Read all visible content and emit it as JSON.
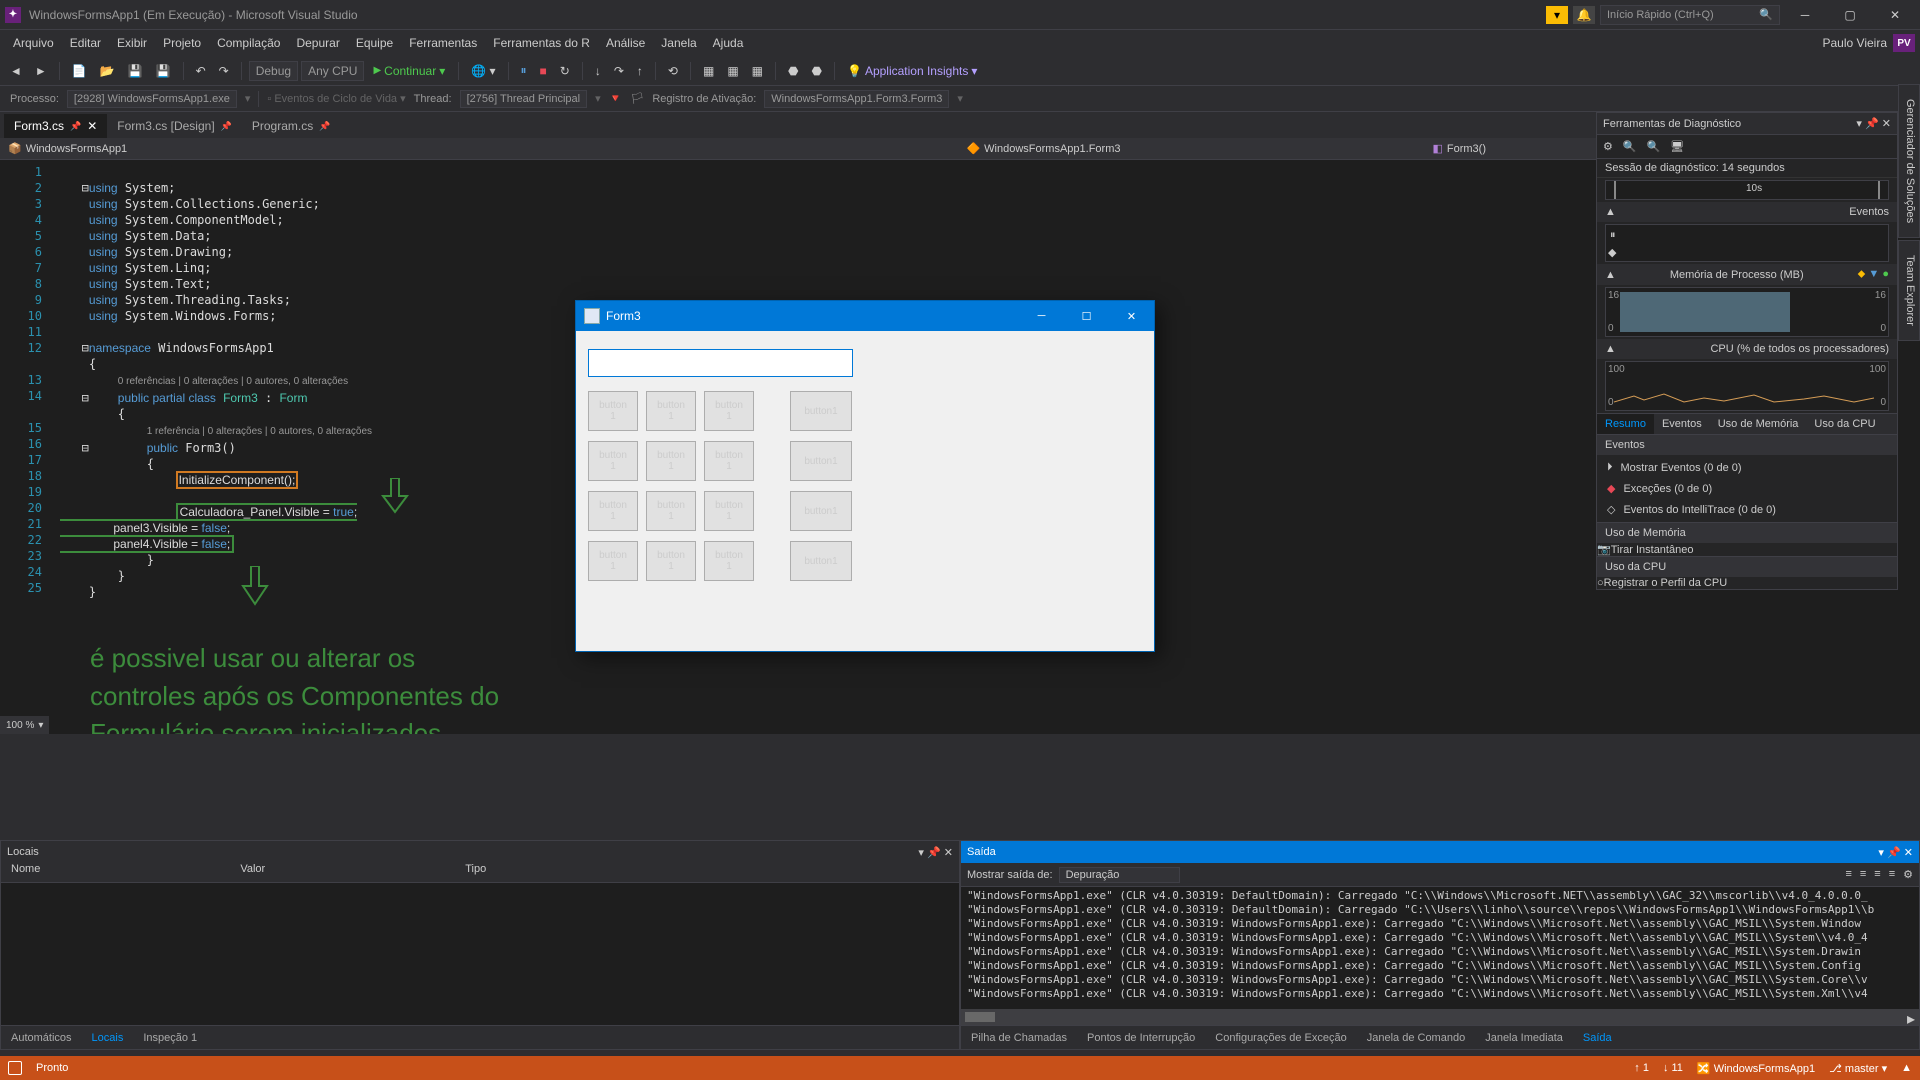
{
  "title": "WindowsFormsApp1 (Em Execução) - Microsoft Visual Studio",
  "quickLaunch": "Início Rápido (Ctrl+Q)",
  "user": {
    "name": "Paulo Vieira",
    "initials": "PV"
  },
  "menu": [
    "Arquivo",
    "Editar",
    "Exibir",
    "Projeto",
    "Compilação",
    "Depurar",
    "Equipe",
    "Ferramentas",
    "Ferramentas do R",
    "Análise",
    "Janela",
    "Ajuda"
  ],
  "toolbar": {
    "config": "Debug",
    "platform": "Any CPU",
    "continue": "Continuar",
    "appInsights": "Application Insights"
  },
  "process": {
    "label": "Processo:",
    "value": "[2928] WindowsFormsApp1.exe",
    "lifecycle": "Eventos de Ciclo de Vida",
    "thread": "Thread:",
    "threadValue": "[2756] Thread Principal",
    "activation": "Registro de Ativação:",
    "activationValue": "WindowsFormsApp1.Form3.Form3"
  },
  "tabs": [
    {
      "label": "Form3.cs",
      "active": true,
      "pinned": true
    },
    {
      "label": "Form3.cs [Design]",
      "active": false,
      "pinned": true
    },
    {
      "label": "Program.cs",
      "active": false,
      "pinned": true
    }
  ],
  "breadcrumb": {
    "project": "WindowsFormsApp1",
    "class": "WindowsFormsApp1.Form3",
    "method": "Form3()"
  },
  "zoom": "100 %",
  "code": {
    "lines": [
      "1",
      "2",
      "3",
      "4",
      "5",
      "6",
      "7",
      "8",
      "9",
      "10",
      "11",
      "12",
      "13",
      "14",
      "15",
      "16",
      "17",
      "18",
      "19",
      "20",
      "21",
      "22",
      "23",
      "24",
      "25"
    ]
  },
  "annotation": "é possivel usar ou alterar os\ncontroles após os Componentes do\nFormulário serem inicializados.",
  "runForm": {
    "title": "Form3",
    "buttonLabel": "button\n1",
    "wideLabel": "button1"
  },
  "diag": {
    "title": "Ferramentas de Diagnóstico",
    "session": "Sessão de diagnóstico: 14 segundos",
    "timeMark": "10s",
    "events": "Eventos",
    "memory": "Memória de Processo (MB)",
    "memTick": "16",
    "memZero": "0",
    "cpu": "CPU (% de todos os processadores)",
    "cpuTick": "100",
    "cpuZero": "0",
    "tabs": [
      "Resumo",
      "Eventos",
      "Uso de Memória",
      "Uso da CPU"
    ],
    "evHead": "Eventos",
    "ev1": "Mostrar Eventos (0 de 0)",
    "ev2": "Exceções (0 de 0)",
    "ev3": "Eventos do IntelliTrace (0 de 0)",
    "memHead": "Uso de Memória",
    "memAct": "Tirar Instantâneo",
    "cpuHead": "Uso da CPU",
    "cpuAct": "Registrar o Perfil da CPU"
  },
  "locals": {
    "title": "Locais",
    "cols": [
      "Nome",
      "Valor",
      "Tipo"
    ],
    "tabs": [
      "Automáticos",
      "Locais",
      "Inspeção 1"
    ]
  },
  "output": {
    "title": "Saída",
    "showFrom": "Mostrar saída de:",
    "source": "Depuração",
    "lines": [
      "\"WindowsFormsApp1.exe\" (CLR v4.0.30319: DefaultDomain): Carregado \"C:\\\\Windows\\\\Microsoft.NET\\\\assembly\\\\GAC_32\\\\mscorlib\\\\v4.0_4.0.0.0_",
      "\"WindowsFormsApp1.exe\" (CLR v4.0.30319: DefaultDomain): Carregado \"C:\\\\Users\\\\linho\\\\source\\\\repos\\\\WindowsFormsApp1\\\\WindowsFormsApp1\\\\b",
      "\"WindowsFormsApp1.exe\" (CLR v4.0.30319: WindowsFormsApp1.exe): Carregado \"C:\\\\Windows\\\\Microsoft.Net\\\\assembly\\\\GAC_MSIL\\\\System.Window",
      "\"WindowsFormsApp1.exe\" (CLR v4.0.30319: WindowsFormsApp1.exe): Carregado \"C:\\\\Windows\\\\Microsoft.Net\\\\assembly\\\\GAC_MSIL\\\\System\\\\v4.0_4",
      "\"WindowsFormsApp1.exe\" (CLR v4.0.30319: WindowsFormsApp1.exe): Carregado \"C:\\\\Windows\\\\Microsoft.Net\\\\assembly\\\\GAC_MSIL\\\\System.Drawin",
      "\"WindowsFormsApp1.exe\" (CLR v4.0.30319: WindowsFormsApp1.exe): Carregado \"C:\\\\Windows\\\\Microsoft.Net\\\\assembly\\\\GAC_MSIL\\\\System.Config",
      "\"WindowsFormsApp1.exe\" (CLR v4.0.30319: WindowsFormsApp1.exe): Carregado \"C:\\\\Windows\\\\Microsoft.Net\\\\assembly\\\\GAC_MSIL\\\\System.Core\\\\v",
      "\"WindowsFormsApp1.exe\" (CLR v4.0.30319: WindowsFormsApp1.exe): Carregado \"C:\\\\Windows\\\\Microsoft.Net\\\\assembly\\\\GAC_MSIL\\\\System.Xml\\\\v4"
    ],
    "tabs": [
      "Pilha de Chamadas",
      "Pontos de Interrupção",
      "Configurações de Exceção",
      "Janela de Comando",
      "Janela Imediata",
      "Saída"
    ]
  },
  "status": {
    "ready": "Pronto",
    "up": "1",
    "down": "11",
    "repo": "WindowsFormsApp1",
    "branch": "master"
  },
  "sideTabs": [
    "Gerenciador de Soluções",
    "Team Explorer"
  ]
}
